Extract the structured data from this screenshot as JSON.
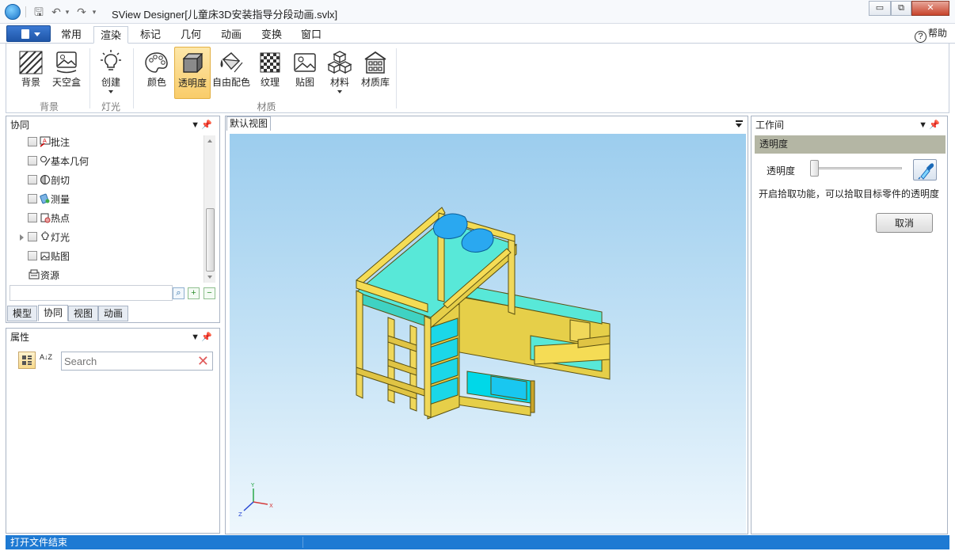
{
  "window": {
    "title": "SView Designer[儿童床3D安装指导分段动画.svlx]",
    "minimize_glyph": "▭",
    "restore_glyph": "⧉",
    "close_glyph": "✕"
  },
  "quick_access": {
    "save_glyph": "🖫",
    "undo_glyph": "↶",
    "redo_glyph": "↷",
    "dropdown_glyph": "▾"
  },
  "ribbon": {
    "tabs": [
      "常用",
      "渲染",
      "标记",
      "几何",
      "动画",
      "变换",
      "窗口"
    ],
    "active_tab": "渲染",
    "help_label": "帮助",
    "help_glyph": "?",
    "groups": {
      "background": {
        "label": "背景",
        "buttons": [
          "背景",
          "天空盒"
        ]
      },
      "light": {
        "label": "灯光",
        "buttons": [
          "创建"
        ]
      },
      "material": {
        "label": "材质",
        "buttons": [
          "颜色",
          "透明度",
          "自由配色",
          "纹理",
          "贴图",
          "材料",
          "材质库"
        ]
      }
    }
  },
  "left_panel": {
    "title": "协同",
    "tree": [
      {
        "label": "批注",
        "icon": "annotation-icon"
      },
      {
        "label": "基本几何",
        "icon": "geometry-icon"
      },
      {
        "label": "剖切",
        "icon": "section-icon"
      },
      {
        "label": "测量",
        "icon": "measure-icon"
      },
      {
        "label": "热点",
        "icon": "hotspot-icon"
      },
      {
        "label": "灯光",
        "icon": "light-icon"
      },
      {
        "label": "贴图",
        "icon": "decal-icon"
      },
      {
        "label": "资源",
        "icon": "resource-icon"
      }
    ],
    "filter_value": "",
    "bottom_tabs": [
      "模型",
      "协同",
      "视图",
      "动画"
    ],
    "active_bottom_tab": "协同"
  },
  "properties_panel": {
    "title": "属性",
    "search_placeholder": "Search",
    "sort_az_glyph": "A↓Z"
  },
  "viewport": {
    "tab_label": "默认视图",
    "axis_labels": {
      "x": "X",
      "y": "Y",
      "z": "Z"
    }
  },
  "right_panel": {
    "title": "工作间",
    "section_title": "透明度",
    "slider_label": "透明度",
    "slider_value": 0,
    "hint_text": "开启拾取功能，可以拾取目标零件的透明度",
    "cancel_label": "取消"
  },
  "status": {
    "message": "打开文件结束"
  },
  "colors": {
    "status_blue": "#1e7ad3",
    "active_button": "#f9cc6a",
    "section_head": "#b4b6a4",
    "bed_wood": "#f0d85a",
    "bed_mattress": "#58e8d8",
    "pillow": "#2aa8f0"
  }
}
